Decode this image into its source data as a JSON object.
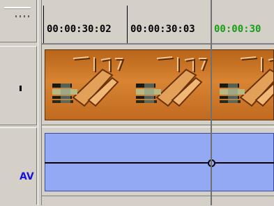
{
  "ruler": {
    "timecodes": [
      "00:00:30:02",
      "00:00:30:03",
      "00:00:30"
    ],
    "current_timecode_color": "#14a014"
  },
  "tracks": {
    "audio_label": "AV",
    "audio_label_color": "#1414d8",
    "video_clip_color": "#c86e1e",
    "audio_clip_color": "#93a9f3"
  },
  "icons": {
    "grip": "grip-icon",
    "keyframe": "keyframe-icon"
  }
}
